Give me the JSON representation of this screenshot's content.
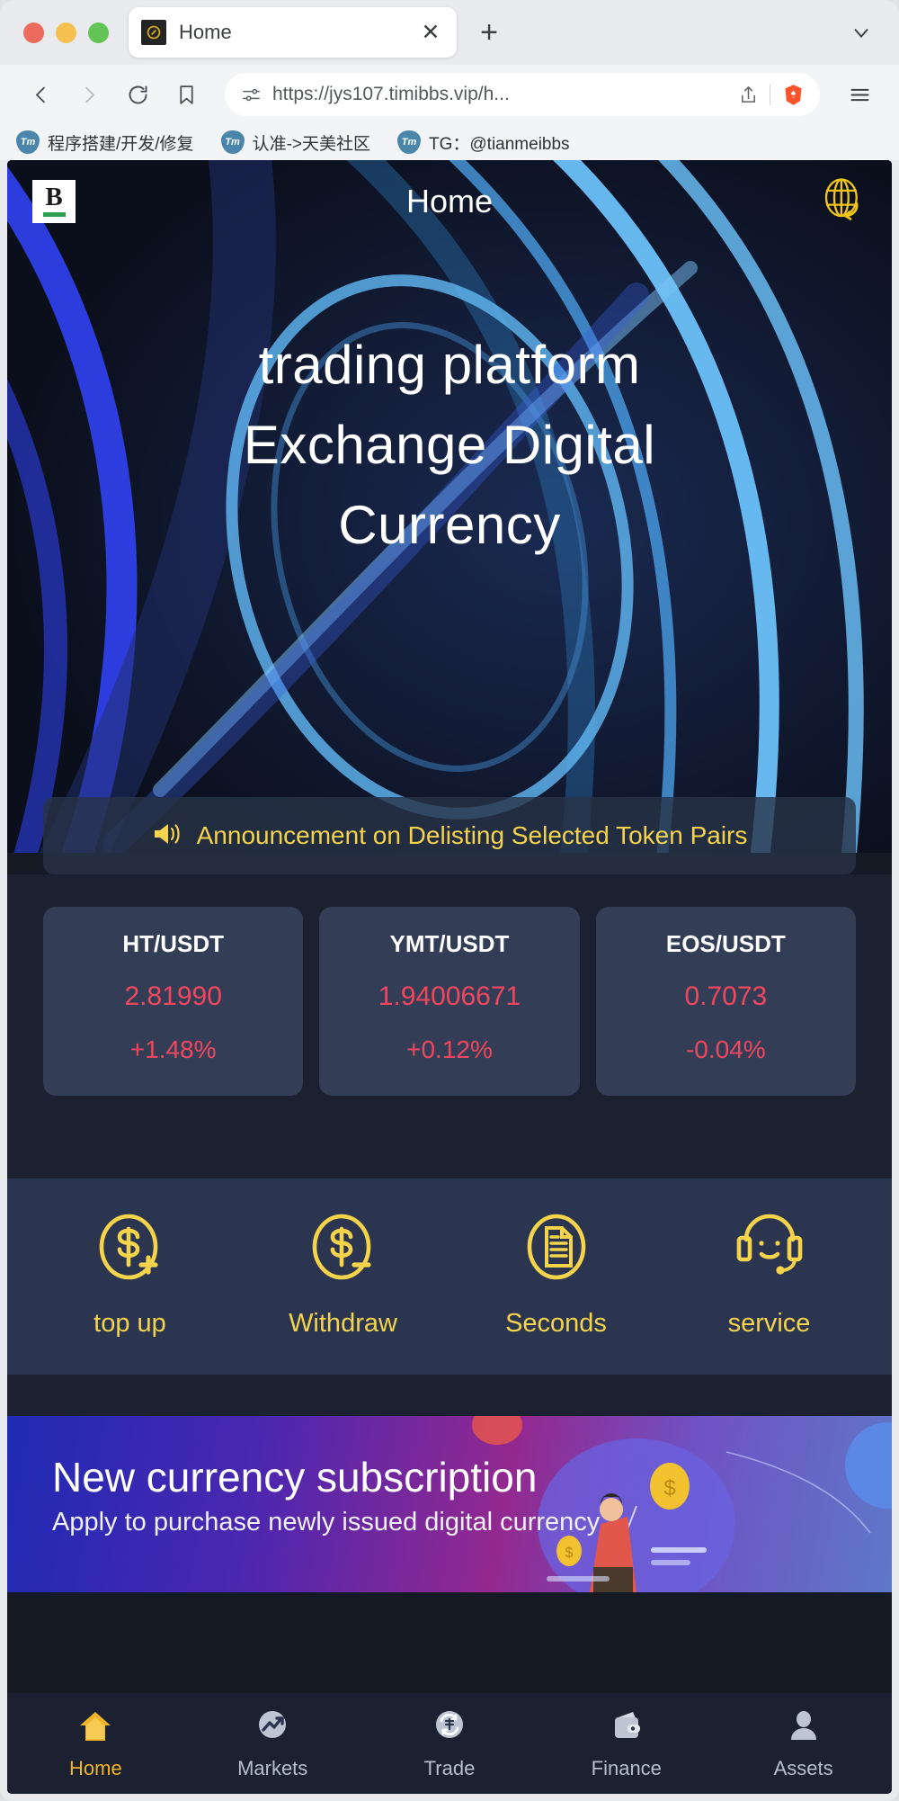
{
  "browser": {
    "tab": {
      "title": "Home",
      "favicon_icon": "coin-favicon",
      "close_icon": "close-icon"
    },
    "new_tab_icon": "plus-icon",
    "tab_list_icon": "chevron-down-icon",
    "nav": {
      "back_icon": "back-arrow-icon",
      "forward_icon": "forward-arrow-icon",
      "reload_icon": "reload-icon",
      "bookmark_icon": "bookmark-icon",
      "url": "https://jys107.timibbs.vip/h...",
      "site_settings_icon": "site-settings-icon",
      "share_icon": "share-icon",
      "shield_icon": "brave-lion-icon",
      "menu_icon": "hamburger-menu-icon"
    },
    "bookmarks": [
      {
        "icon": "tm-bookmark-icon",
        "label": "程序搭建/开发/修复"
      },
      {
        "icon": "tm-bookmark-icon",
        "label": "认准->天美社区"
      },
      {
        "icon": "tm-bookmark-icon",
        "label": "TG：@tianmeibbs"
      }
    ]
  },
  "page": {
    "header": {
      "logo_letter": "B",
      "title": "Home",
      "language_icon": "globe-language-icon"
    },
    "hero": {
      "line1": "trading platform",
      "line2": "Exchange Digital",
      "line3": "Currency"
    },
    "announcement": {
      "icon": "speaker-announce-icon",
      "text": "Announcement on Delisting Selected Token Pairs"
    },
    "tickers": [
      {
        "pair": "HT/USDT",
        "price": "2.81990",
        "change": "+1.48%",
        "color": "#f0475f"
      },
      {
        "pair": "YMT/USDT",
        "price": "1.94006671",
        "change": "+0.12%",
        "color": "#f0475f"
      },
      {
        "pair": "EOS/USDT",
        "price": "0.7073",
        "change": "-0.04%",
        "color": "#f0475f"
      }
    ],
    "quick_actions": [
      {
        "icon": "dollar-plus-circle-icon",
        "label": "top up"
      },
      {
        "icon": "dollar-minus-circle-icon",
        "label": "Withdraw"
      },
      {
        "icon": "document-circle-icon",
        "label": "Seconds"
      },
      {
        "icon": "headset-support-icon",
        "label": "service"
      }
    ],
    "banner": {
      "title": "New currency subscription",
      "subtitle": "Apply to purchase newly issued digital currency"
    },
    "bottom_nav": [
      {
        "icon": "home-icon",
        "label": "Home",
        "active": true
      },
      {
        "icon": "markets-trend-icon",
        "label": "Markets",
        "active": false
      },
      {
        "icon": "trade-swap-icon",
        "label": "Trade",
        "active": false
      },
      {
        "icon": "wallet-icon",
        "label": "Finance",
        "active": false
      },
      {
        "icon": "person-icon",
        "label": "Assets",
        "active": false
      }
    ]
  },
  "colors": {
    "accent_yellow": "#f5d44c",
    "price_red": "#f0475f",
    "logo_green": "#2e9e4f",
    "page_dark": "#1b2130",
    "card_blue": "#333e56",
    "quick_panel": "#2b3550"
  }
}
